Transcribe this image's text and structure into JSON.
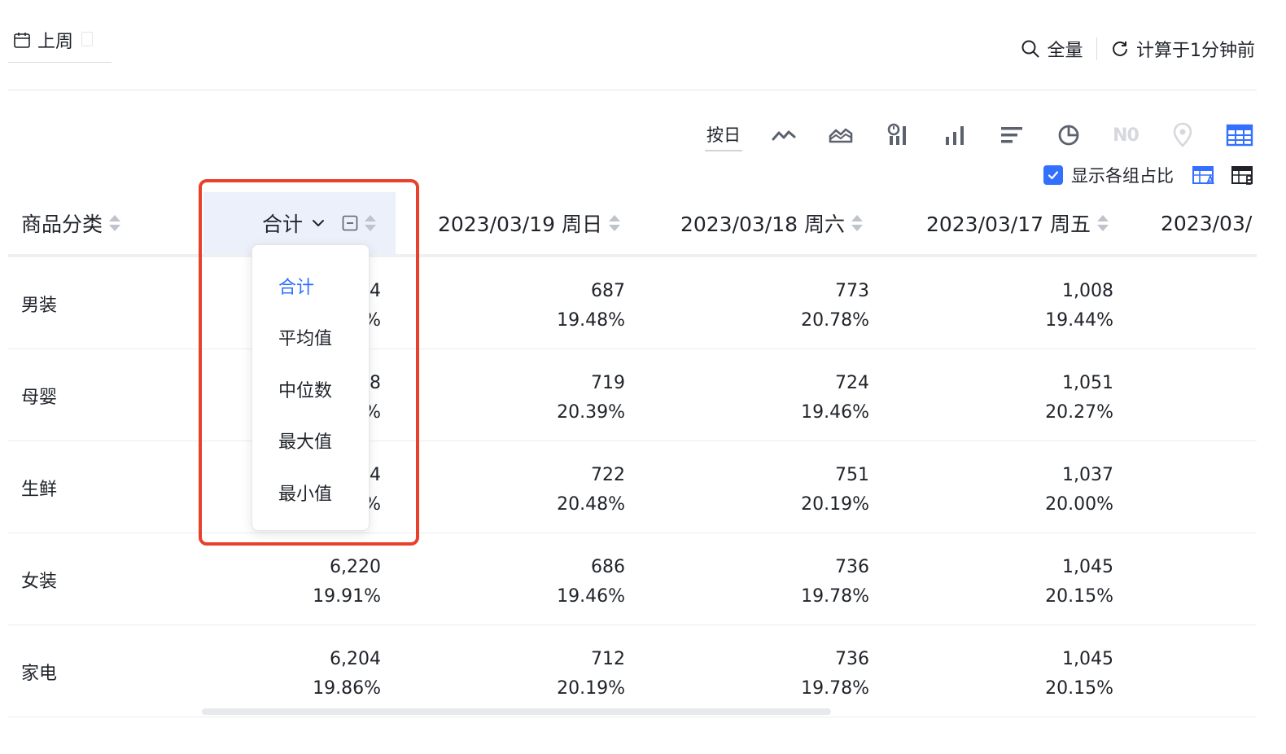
{
  "header": {
    "date_range": "上周",
    "scope": "全量",
    "computed": "计算于1分钟前"
  },
  "toolbar": {
    "granularity": "按日",
    "disabled_label": "N0",
    "show_share_label": "显示各组占比",
    "show_share_checked": true,
    "accent": "#3370ff"
  },
  "table": {
    "columns": {
      "category": "商品分类",
      "total": "合计",
      "d1": "2023/03/19 周日",
      "d2": "2023/03/18 周六",
      "d3": "2023/03/17 周五",
      "d4": "2023/03/"
    },
    "rows": [
      {
        "category": "男装",
        "total": "4",
        "total_pct": "%",
        "d1": "687",
        "d1_pct": "19.48%",
        "d2": "773",
        "d2_pct": "20.78%",
        "d3": "1,008",
        "d3_pct": "19.44%"
      },
      {
        "category": "母婴",
        "total": "8",
        "total_pct": "%",
        "d1": "719",
        "d1_pct": "20.39%",
        "d2": "724",
        "d2_pct": "19.46%",
        "d3": "1,051",
        "d3_pct": "20.27%"
      },
      {
        "category": "生鲜",
        "total": "4",
        "total_pct": "%",
        "d1": "722",
        "d1_pct": "20.48%",
        "d2": "751",
        "d2_pct": "20.19%",
        "d3": "1,037",
        "d3_pct": "20.00%"
      },
      {
        "category": "女装",
        "total": "6,220",
        "total_pct": "19.91%",
        "d1": "686",
        "d1_pct": "19.46%",
        "d2": "736",
        "d2_pct": "19.78%",
        "d3": "1,045",
        "d3_pct": "20.15%"
      },
      {
        "category": "家电",
        "total": "6,204",
        "total_pct": "19.86%",
        "d1": "712",
        "d1_pct": "20.19%",
        "d2": "736",
        "d2_pct": "19.78%",
        "d3": "1,045",
        "d3_pct": "20.15%"
      }
    ]
  },
  "aggregation_menu": {
    "selected": "合计",
    "options": [
      "合计",
      "平均值",
      "中位数",
      "最大值",
      "最小值"
    ]
  },
  "highlight_color": "#e8412b"
}
